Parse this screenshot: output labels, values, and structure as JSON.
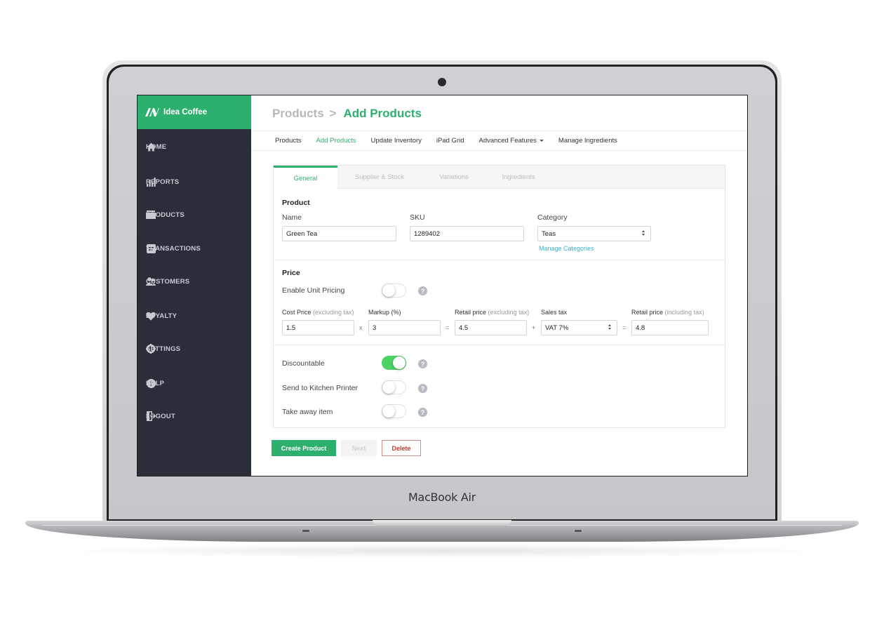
{
  "device": {
    "brand_label": "MacBook Air"
  },
  "app": {
    "name": "Idea Coffee",
    "accent_color": "#2daf6e",
    "sidebar_color": "#2a2e39"
  },
  "sidebar": {
    "items": [
      {
        "label": "HOME",
        "icon": "home-icon"
      },
      {
        "label": "REPORTS",
        "icon": "bar-chart-icon"
      },
      {
        "label": "PRODUCTS",
        "icon": "box-icon"
      },
      {
        "label": "TRANSACTIONS",
        "icon": "receipt-icon"
      },
      {
        "label": "CUSTOMERS",
        "icon": "users-icon"
      },
      {
        "label": "LOYALTY",
        "icon": "heart-icon"
      },
      {
        "label": "SETTINGS",
        "icon": "gear-icon"
      },
      {
        "label": "HELP",
        "icon": "help-circle-icon"
      },
      {
        "label": "LOGOUT",
        "icon": "logout-icon"
      }
    ]
  },
  "breadcrumb": {
    "parent": "Products",
    "separator": ">",
    "current": "Add Products"
  },
  "subnav": {
    "links": [
      {
        "label": "Products",
        "active": false
      },
      {
        "label": "Add Products",
        "active": true
      },
      {
        "label": "Update Inventory",
        "active": false
      },
      {
        "label": "iPad Grid",
        "active": false
      },
      {
        "label": "Advanced Features",
        "active": false,
        "dropdown": true
      },
      {
        "label": "Manage Ingredients",
        "active": false
      }
    ]
  },
  "tabs": [
    {
      "label": "General",
      "active": true
    },
    {
      "label": "Supplier & Stock",
      "active": false
    },
    {
      "label": "Variations",
      "active": false
    },
    {
      "label": "Ingredients",
      "active": false
    }
  ],
  "product": {
    "section_title": "Product",
    "name_label": "Name",
    "name_value": "Green Tea",
    "sku_label": "SKU",
    "sku_value": "1289402",
    "category_label": "Category",
    "category_value": "Teas",
    "manage_categories_link": "Manage Categories"
  },
  "price": {
    "section_title": "Price",
    "unit_pricing_label": "Enable Unit Pricing",
    "unit_pricing_on": false,
    "cost_label": "Cost Price",
    "cost_hint": "(excluding tax)",
    "cost_value": "1.5",
    "markup_label": "Markup (%)",
    "markup_value": "3",
    "retail_ex_label": "Retail price",
    "retail_ex_hint": "(excluding tax)",
    "retail_ex_value": "4.5",
    "sales_tax_label": "Sales tax",
    "sales_tax_value": "VAT 7%",
    "retail_inc_label": "Retail price",
    "retail_inc_hint": "(including tax)",
    "retail_inc_value": "4.8",
    "op_multiply": "x",
    "op_equals": "=",
    "op_plus": "+"
  },
  "options": [
    {
      "label": "Discountable",
      "on": true
    },
    {
      "label": "Send to Kitchen Printer",
      "on": false
    },
    {
      "label": "Take away item",
      "on": false
    }
  ],
  "help_glyph": "?",
  "actions": {
    "create": "Create Product",
    "next": "Next",
    "delete": "Delete"
  }
}
